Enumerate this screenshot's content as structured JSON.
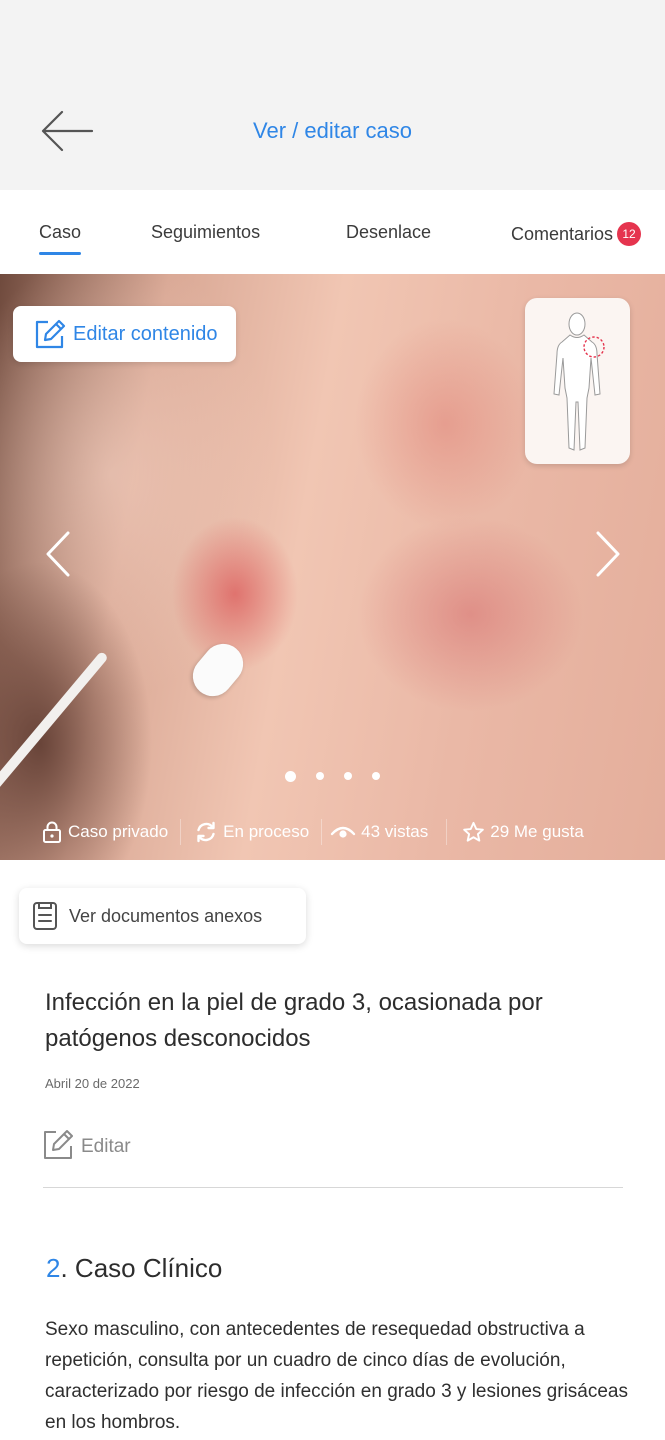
{
  "header": {
    "title": "Ver / editar caso"
  },
  "tabs": [
    {
      "label": "Caso",
      "active": true
    },
    {
      "label": "Seguimientos"
    },
    {
      "label": "Desenlace"
    },
    {
      "label": "Comentarios",
      "badge": "12"
    }
  ],
  "hero": {
    "edit_label": "Editar contenido",
    "carousel": {
      "total": 4,
      "current": 1
    },
    "stats": {
      "privacy": "Caso privado",
      "status": "En proceso",
      "views": "43 vistas",
      "likes": "29 Me gusta"
    }
  },
  "docs": {
    "label": "Ver documentos anexos"
  },
  "case": {
    "title": "Infección en la piel de grado 3, ocasionada por patógenos desconocidos",
    "date": "Abril 20 de 2022",
    "edit_label": "Editar"
  },
  "section": {
    "number": "2",
    "title": ". Caso Clínico",
    "body": "Sexo masculino, con antecedentes de resequedad obstructiva a repetición, consulta por un cuadro de cinco días de evolución, caracterizado por riesgo de infección en grado 3 y lesiones grisáceas en los hombros."
  },
  "colors": {
    "accent": "#2f86e6",
    "badge": "#e5344e"
  },
  "icons": [
    "back-arrow-icon",
    "edit-icon",
    "chevron-left-icon",
    "chevron-right-icon",
    "lock-icon",
    "refresh-icon",
    "eye-icon",
    "star-icon",
    "document-icon"
  ]
}
